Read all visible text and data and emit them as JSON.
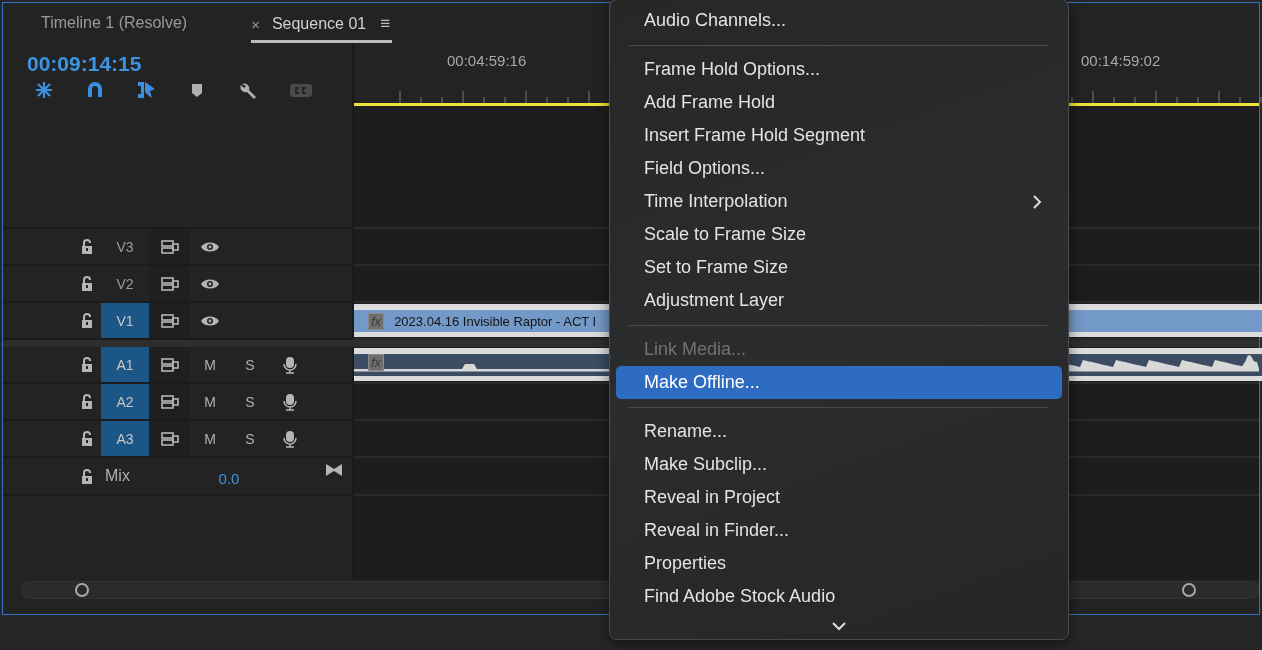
{
  "tabs": [
    {
      "label": "Timeline 1 (Resolve)",
      "selected": false
    },
    {
      "label": "Sequence 01",
      "selected": true,
      "close": "×",
      "menu": "≡"
    }
  ],
  "timecode": "00:09:14:15",
  "toolbar": [
    {
      "kind": "snap",
      "active": true,
      "disabled": false
    },
    {
      "kind": "magnet",
      "active": true,
      "disabled": false
    },
    {
      "kind": "linked",
      "active": true,
      "disabled": false
    },
    {
      "kind": "marker",
      "active": false,
      "disabled": false
    },
    {
      "kind": "wrench",
      "active": false,
      "disabled": false
    },
    {
      "kind": "cc",
      "active": false,
      "disabled": true
    }
  ],
  "ruler": {
    "labels": [
      "00:04:59:16",
      "00:14:59:02"
    ]
  },
  "tracks": [
    {
      "kind": "video",
      "name": "V3",
      "targeted": false
    },
    {
      "kind": "video",
      "name": "V2",
      "targeted": false
    },
    {
      "kind": "video",
      "name": "V1",
      "targeted": true,
      "clip": {
        "fx": "fx",
        "title": "2023.04.16 Invisible Raptor - ACT I"
      }
    },
    {
      "kind": "audio",
      "name": "A1",
      "targeted": true,
      "mute": "M",
      "solo": "S",
      "clip": {
        "fx": "fx"
      }
    },
    {
      "kind": "audio",
      "name": "A2",
      "targeted": true,
      "mute": "M",
      "solo": "S"
    },
    {
      "kind": "audio",
      "name": "A3",
      "targeted": true,
      "mute": "M",
      "solo": "S"
    },
    {
      "kind": "mix",
      "name": "Mix",
      "value": "0.0"
    }
  ],
  "context_menu": {
    "items": [
      {
        "kind": "item",
        "label": "Audio Channels...",
        "disabled": false,
        "selected": false,
        "submenu": false
      },
      {
        "kind": "separator"
      },
      {
        "kind": "item",
        "label": "Frame Hold Options...",
        "disabled": false,
        "selected": false,
        "submenu": false
      },
      {
        "kind": "item",
        "label": "Add Frame Hold",
        "disabled": false,
        "selected": false,
        "submenu": false
      },
      {
        "kind": "item",
        "label": "Insert Frame Hold Segment",
        "disabled": false,
        "selected": false,
        "submenu": false
      },
      {
        "kind": "item",
        "label": "Field Options...",
        "disabled": false,
        "selected": false,
        "submenu": false
      },
      {
        "kind": "item",
        "label": "Time Interpolation",
        "disabled": false,
        "selected": false,
        "submenu": true
      },
      {
        "kind": "item",
        "label": "Scale to Frame Size",
        "disabled": false,
        "selected": false,
        "submenu": false
      },
      {
        "kind": "item",
        "label": "Set to Frame Size",
        "disabled": false,
        "selected": false,
        "submenu": false
      },
      {
        "kind": "item",
        "label": "Adjustment Layer",
        "disabled": false,
        "selected": false,
        "submenu": false
      },
      {
        "kind": "separator"
      },
      {
        "kind": "item",
        "label": "Link Media...",
        "disabled": true,
        "selected": false,
        "submenu": false
      },
      {
        "kind": "item",
        "label": "Make Offline...",
        "disabled": false,
        "selected": true,
        "submenu": false
      },
      {
        "kind": "separator"
      },
      {
        "kind": "item",
        "label": "Rename...",
        "disabled": false,
        "selected": false,
        "submenu": false
      },
      {
        "kind": "item",
        "label": "Make Subclip...",
        "disabled": false,
        "selected": false,
        "submenu": false
      },
      {
        "kind": "item",
        "label": "Reveal in Project",
        "disabled": false,
        "selected": false,
        "submenu": false
      },
      {
        "kind": "item",
        "label": "Reveal in Finder...",
        "disabled": false,
        "selected": false,
        "submenu": false
      },
      {
        "kind": "item",
        "label": "Properties",
        "disabled": false,
        "selected": false,
        "submenu": false
      },
      {
        "kind": "item",
        "label": "Find Adobe Stock Audio",
        "disabled": false,
        "selected": false,
        "submenu": false
      }
    ]
  }
}
